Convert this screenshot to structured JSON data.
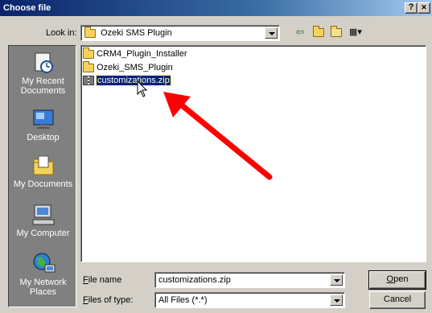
{
  "dialog": {
    "title": "Choose file",
    "help_label": "?",
    "close_label": "✕"
  },
  "lookin": {
    "label": "Look in:",
    "value": "Ozeki SMS Plugin"
  },
  "toolbar": {
    "back_icon": "⇦",
    "up_icon": "↑",
    "views_icon": "▦▾"
  },
  "places": [
    {
      "label": "My Recent Documents",
      "icon": "recent-documents-icon"
    },
    {
      "label": "Desktop",
      "icon": "desktop-icon"
    },
    {
      "label": "My Documents",
      "icon": "my-documents-icon"
    },
    {
      "label": "My Computer",
      "icon": "my-computer-icon"
    },
    {
      "label": "My Network Places",
      "icon": "network-places-icon"
    }
  ],
  "files": [
    {
      "name": "CRM4_Plugin_Installer",
      "type": "folder",
      "selected": false
    },
    {
      "name": "Ozeki_SMS_Plugin",
      "type": "folder",
      "selected": false
    },
    {
      "name": "customizations.zip",
      "type": "zip",
      "selected": true
    }
  ],
  "filename": {
    "label": "File name",
    "value": "customizations.zip"
  },
  "filetype": {
    "label": "Files of type:",
    "value": "All Files (*.*)"
  },
  "buttons": {
    "open_label": "Open",
    "cancel_label": "Cancel"
  },
  "annotation": {
    "arrow_color": "#ff0000"
  }
}
